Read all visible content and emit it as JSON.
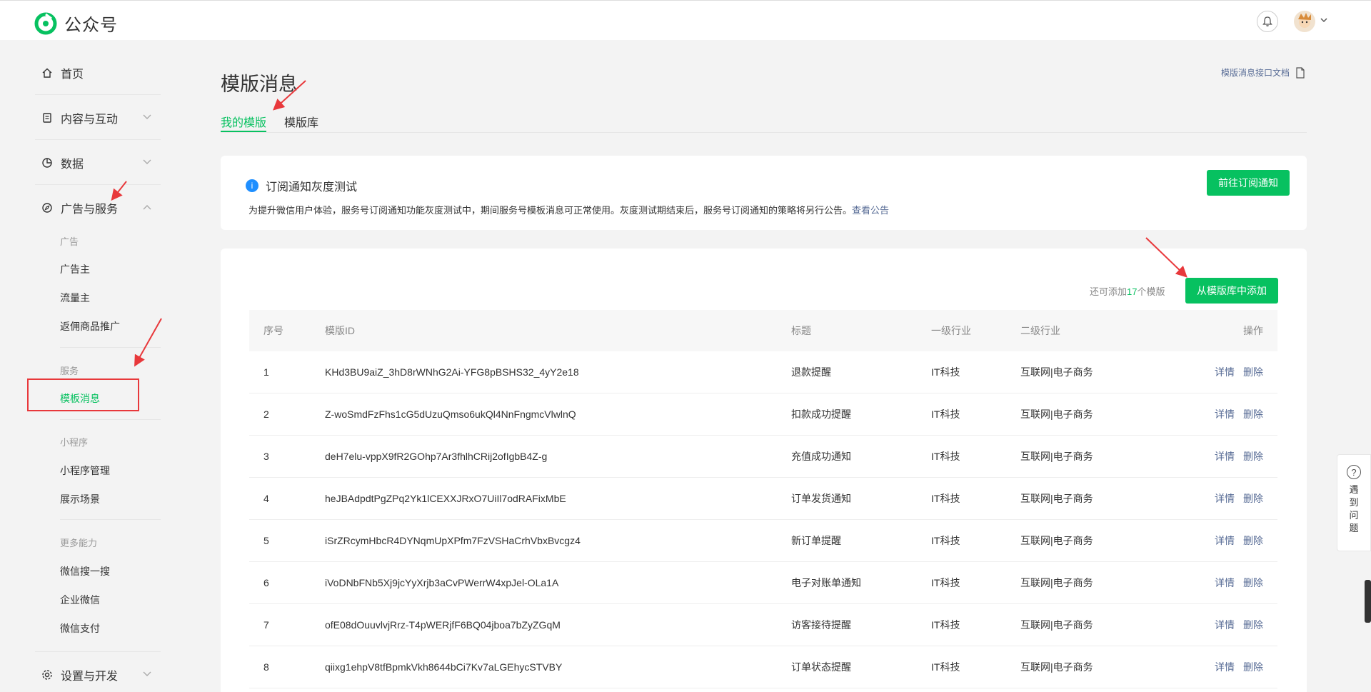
{
  "app": {
    "name": "公众号"
  },
  "sidebar": {
    "home": "首页",
    "content": "内容与互动",
    "data": "数据",
    "ads": "广告与服务",
    "ads_group": "广告",
    "advertiser": "广告主",
    "publisher": "流量主",
    "rebate": "返佣商品推广",
    "service_group": "服务",
    "template_msg": "模板消息",
    "mini_group": "小程序",
    "mini_manage": "小程序管理",
    "scene": "展示场景",
    "more_group": "更多能力",
    "wx_search": "微信搜一搜",
    "work_wx": "企业微信",
    "wx_pay": "微信支付",
    "settings": "设置与开发"
  },
  "page": {
    "title": "模版消息",
    "doc_link": "模版消息接口文档",
    "tabs": [
      "我的模版",
      "模版库"
    ]
  },
  "notice": {
    "icon": "i",
    "title": "订阅通知灰度测试",
    "desc": "为提升微信用户体验，服务号订阅通知功能灰度测试中，期间服务号模板消息可正常使用。灰度测试期结束后，服务号订阅通知的策略将另行公告。",
    "link": "查看公告",
    "button": "前往订阅通知"
  },
  "list": {
    "remain_prefix": "还可添加",
    "remain_count": "17",
    "remain_suffix": "个模版",
    "add_button": "从模版库中添加",
    "headers": {
      "no": "序号",
      "id": "模版ID",
      "title": "标题",
      "ind1": "一级行业",
      "ind2": "二级行业",
      "op": "操作"
    },
    "detail": "详情",
    "delete": "删除",
    "rows": [
      {
        "no": "1",
        "id": "KHd3BU9aiZ_3hD8rWNhG2Ai-YFG8pBSHS32_4yY2e18",
        "title": "退款提醒",
        "ind1": "IT科技",
        "ind2": "互联网|电子商务"
      },
      {
        "no": "2",
        "id": "Z-woSmdFzFhs1cG5dUzuQmso6ukQl4NnFngmcVlwlnQ",
        "title": "扣款成功提醒",
        "ind1": "IT科技",
        "ind2": "互联网|电子商务"
      },
      {
        "no": "3",
        "id": "deH7elu-vppX9fR2GOhp7Ar3fhlhCRij2ofIgbB4Z-g",
        "title": "充值成功通知",
        "ind1": "IT科技",
        "ind2": "互联网|电子商务"
      },
      {
        "no": "4",
        "id": "heJBAdpdtPgZPq2Yk1lCEXXJRxO7UiIl7odRAFixMbE",
        "title": "订单发货通知",
        "ind1": "IT科技",
        "ind2": "互联网|电子商务"
      },
      {
        "no": "5",
        "id": "iSrZRcymHbcR4DYNqmUpXPfm7FzVSHaCrhVbxBvcgz4",
        "title": "新订单提醒",
        "ind1": "IT科技",
        "ind2": "互联网|电子商务"
      },
      {
        "no": "6",
        "id": "iVoDNbFNb5Xj9jcYyXrjb3aCvPWerrW4xpJel-OLa1A",
        "title": "电子对账单通知",
        "ind1": "IT科技",
        "ind2": "互联网|电子商务"
      },
      {
        "no": "7",
        "id": "ofE08dOuuvlvjRrz-T4pWERjfF6BQ04jboa7bZyZGqM",
        "title": "访客接待提醒",
        "ind1": "IT科技",
        "ind2": "互联网|电子商务"
      },
      {
        "no": "8",
        "id": "qiixg1ehpV8tfBpmkVkh8644bCi7Kv7aLGEhycSTVBY",
        "title": "订单状态提醒",
        "ind1": "IT科技",
        "ind2": "互联网|电子商务"
      }
    ]
  },
  "help": {
    "icon": "?",
    "text": "遇到问题"
  }
}
